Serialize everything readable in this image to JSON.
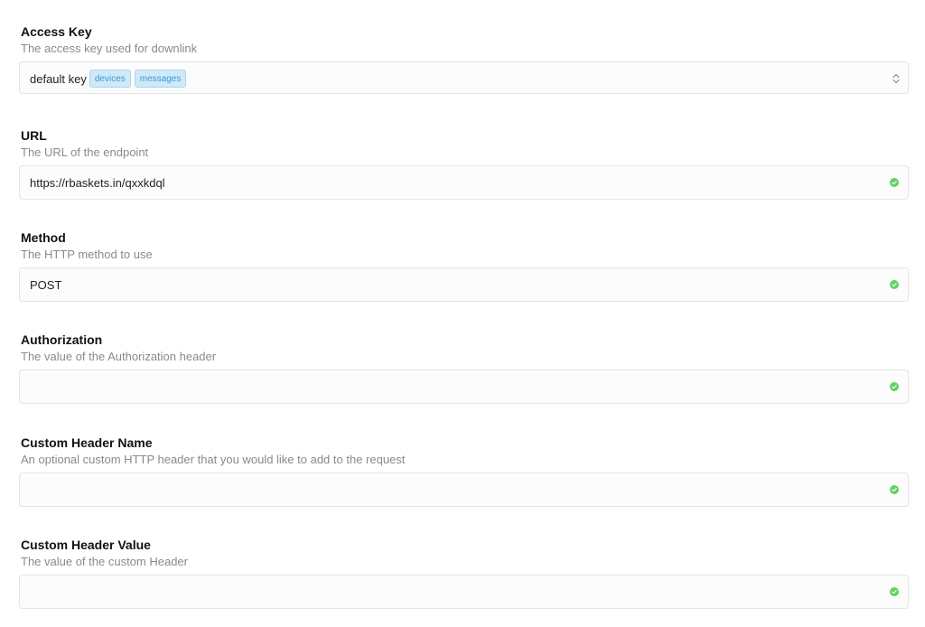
{
  "access_key": {
    "label": "Access Key",
    "description": "The access key used for downlink",
    "selected_value": "default key",
    "tags": [
      "devices",
      "messages"
    ]
  },
  "url": {
    "label": "URL",
    "description": "The URL of the endpoint",
    "value": "https://rbaskets.in/qxxkdql"
  },
  "method": {
    "label": "Method",
    "description": "The HTTP method to use",
    "value": "POST"
  },
  "authorization": {
    "label": "Authorization",
    "description": "The value of the Authorization header",
    "value": ""
  },
  "custom_header_name": {
    "label": "Custom Header Name",
    "description": "An optional custom HTTP header that you would like to add to the request",
    "value": ""
  },
  "custom_header_value": {
    "label": "Custom Header Value",
    "description": "The value of the custom Header",
    "value": ""
  },
  "icons": {
    "valid": "check-circle-icon",
    "select": "chevron-up-down-icon"
  },
  "colors": {
    "valid": "#5fd35f",
    "tag_bg": "#cfe9f7",
    "tag_text": "#3a9ad9"
  }
}
